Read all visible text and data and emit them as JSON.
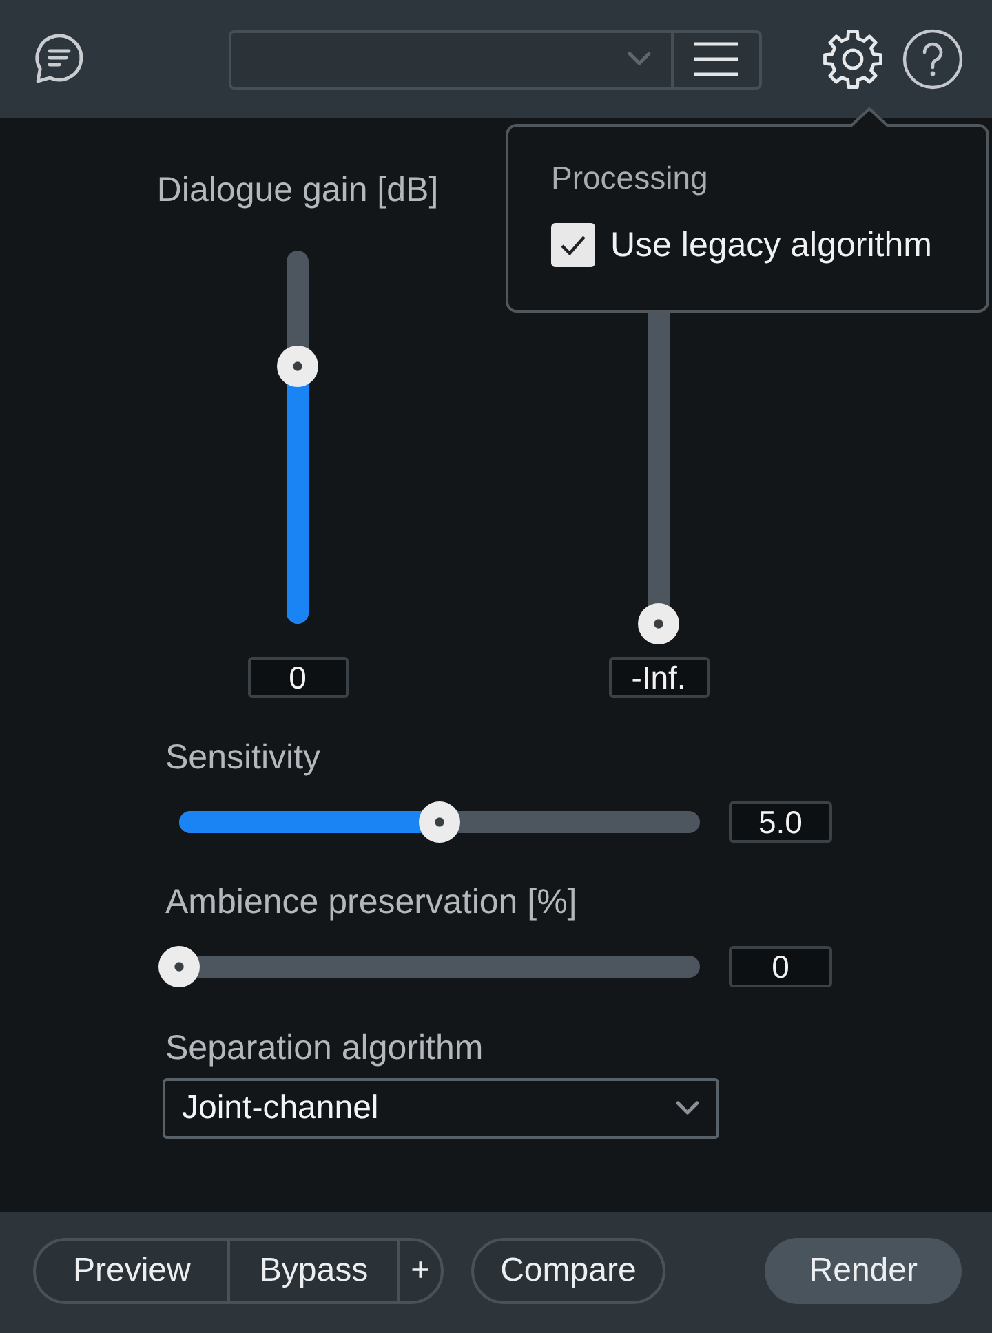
{
  "popover": {
    "title": "Processing",
    "options": [
      {
        "label": "Use legacy algorithm",
        "checked": true
      }
    ]
  },
  "vertical_sliders": [
    {
      "label": "Dialogue gain [dB]",
      "level": 0.69,
      "reading": "0"
    },
    {
      "level": 0,
      "reading": "-Inf."
    }
  ],
  "sliders": [
    {
      "label": "Sensitivity",
      "level": 0.5,
      "reading": "5.0"
    },
    {
      "label": "Ambience preservation [%]",
      "level": 0,
      "reading": "0"
    }
  ],
  "separation_algorithm": {
    "label": "Separation algorithm",
    "value": "Joint-channel"
  },
  "footer": {
    "buttons": [
      {
        "label": "Preview",
        "kind": "segment"
      },
      {
        "label": "Bypass",
        "kind": "segment"
      },
      {
        "label": "+",
        "kind": "segment"
      },
      {
        "label": "Compare",
        "kind": "outline"
      },
      {
        "label": "Render",
        "kind": "primary"
      }
    ]
  }
}
